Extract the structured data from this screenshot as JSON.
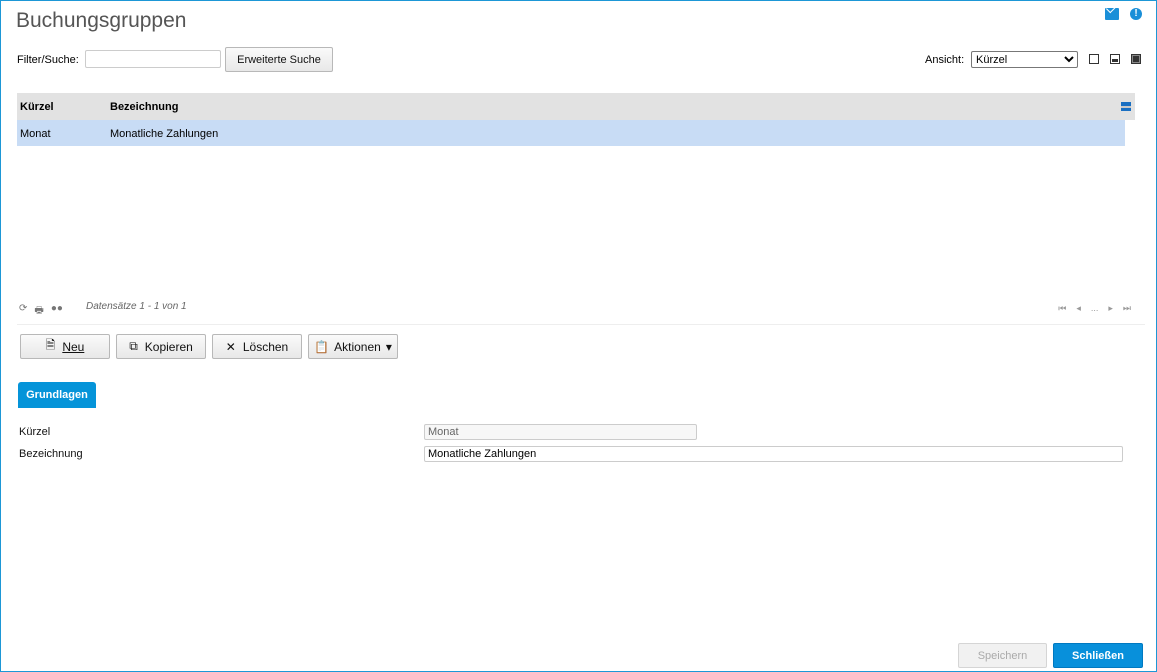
{
  "window": {
    "title": "Buchungsgruppen",
    "accent": "#0594d9"
  },
  "header_icons": {
    "mail": "mail-icon",
    "help": "help-icon",
    "help_glyph": "!"
  },
  "toolbar": {
    "filter_label": "Filter/Suche:",
    "filter_value": "",
    "extended_search_label": "Erweiterte Suche",
    "view_label": "Ansicht:",
    "view_value": "Kürzel"
  },
  "grid": {
    "columns": [
      "Kürzel",
      "Bezeichnung"
    ],
    "rows": [
      {
        "kuerzel": "Monat",
        "bezeichnung": "Monatliche Zahlungen",
        "selected": true
      }
    ],
    "footer": {
      "info": "Datensätze 1 - 1 von 1",
      "pager_ellipsis": "..."
    }
  },
  "actions": {
    "new_label": "Neu",
    "copy_label": "Kopieren",
    "delete_label": "Löschen",
    "actions_label": "Aktionen"
  },
  "tabs": [
    {
      "label": "Grundlagen",
      "active": true
    }
  ],
  "form": {
    "kuerzel_label": "Kürzel",
    "kuerzel_value": "Monat",
    "bezeichnung_label": "Bezeichnung",
    "bezeichnung_value": "Monatliche Zahlungen"
  },
  "footer_buttons": {
    "save_label": "Speichern",
    "close_label": "Schließen"
  }
}
